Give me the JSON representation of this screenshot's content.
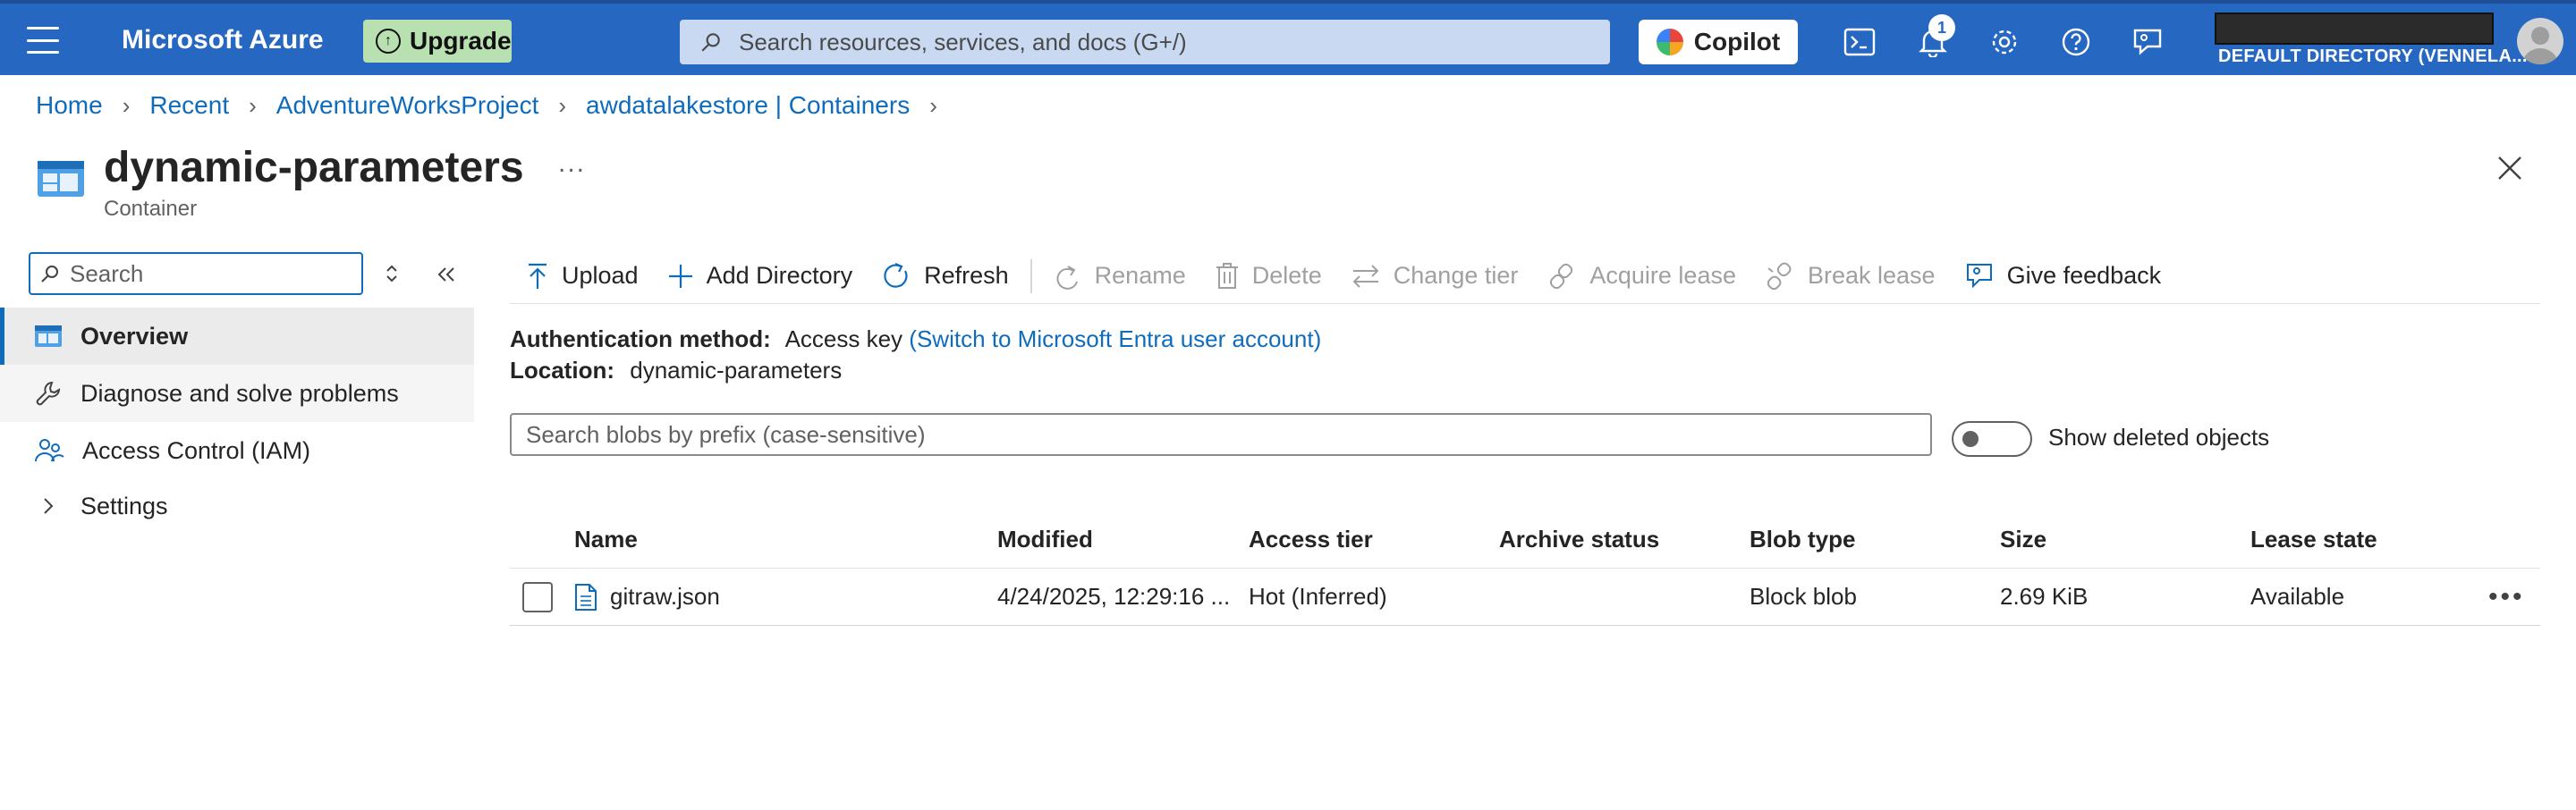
{
  "topbar": {
    "brand": "Microsoft Azure",
    "upgrade_label": "Upgrade",
    "search_placeholder": "Search resources, services, and docs (G+/)",
    "copilot_label": "Copilot",
    "notification_count": "1",
    "directory": "DEFAULT DIRECTORY (VENNELA..."
  },
  "breadcrumb": [
    "Home",
    "Recent",
    "AdventureWorksProject",
    "awdatalakestore | Containers"
  ],
  "page": {
    "title": "dynamic-parameters",
    "more": "...",
    "subtitle": "Container"
  },
  "nav": {
    "search_placeholder": "Search",
    "items": [
      {
        "label": "Overview",
        "icon": "container-icon"
      },
      {
        "label": "Diagnose and solve problems",
        "icon": "wrench-icon"
      },
      {
        "label": "Access Control (IAM)",
        "icon": "people-icon"
      },
      {
        "label": "Settings",
        "icon": "chevron-right-icon"
      }
    ]
  },
  "commands": {
    "upload": "Upload",
    "add_directory": "Add Directory",
    "refresh": "Refresh",
    "rename": "Rename",
    "delete": "Delete",
    "change_tier": "Change tier",
    "acquire_lease": "Acquire lease",
    "break_lease": "Break lease",
    "give_feedback": "Give feedback"
  },
  "info": {
    "auth_label": "Authentication method:",
    "auth_value": "Access key",
    "auth_link": "(Switch to Microsoft Entra user account)",
    "location_label": "Location:",
    "location_value": "dynamic-parameters"
  },
  "blob_search_placeholder": "Search blobs by prefix (case-sensitive)",
  "show_deleted_label": "Show deleted objects",
  "show_deleted_on": false,
  "table": {
    "columns": [
      "Name",
      "Modified",
      "Access tier",
      "Archive status",
      "Blob type",
      "Size",
      "Lease state"
    ],
    "rows": [
      {
        "name": "gitraw.json",
        "modified": "4/24/2025, 12:29:16 ...",
        "access_tier": "Hot (Inferred)",
        "archive_status": "",
        "blob_type": "Block blob",
        "size": "2.69 KiB",
        "lease_state": "Available"
      }
    ]
  },
  "colors": {
    "topbar": "#2667c2",
    "link": "#0f6cbd",
    "upgrade_bg": "#b8e0b1"
  }
}
